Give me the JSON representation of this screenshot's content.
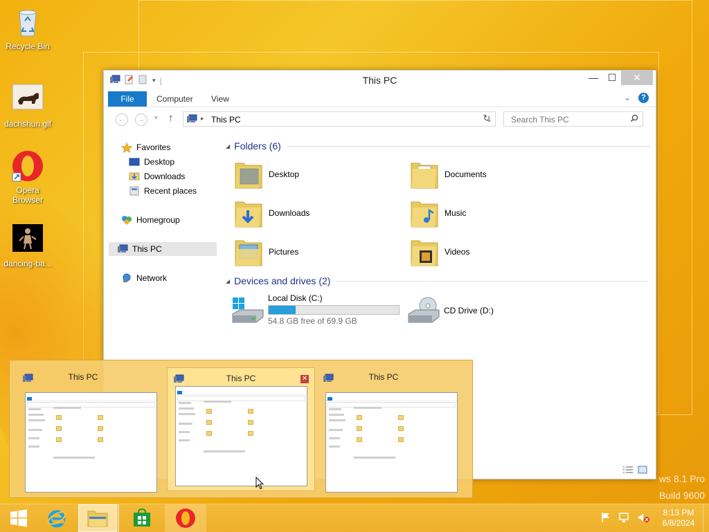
{
  "desktop": {
    "icons": [
      {
        "label": "Recycle Bin",
        "icon": "recycle-bin-icon"
      },
      {
        "label": "dachshun.gif",
        "icon": "gif-image-icon"
      },
      {
        "label": "Opera Browser",
        "icon": "opera-icon"
      },
      {
        "label": "dancing-ba...",
        "icon": "video-file-icon"
      }
    ],
    "watermark": {
      "line1": "ws 8.1 Pro",
      "line2": "Build 9600"
    }
  },
  "window": {
    "title": "This PC",
    "controls": {
      "minimize": "—",
      "maximize": "☐",
      "close": "✕"
    },
    "ribbon_tabs": {
      "file": "File",
      "computer": "Computer",
      "view": "View"
    },
    "address": {
      "path": "This PC"
    },
    "search": {
      "placeholder": "Search This PC"
    },
    "nav": {
      "favorites": "Favorites",
      "desktop": "Desktop",
      "downloads": "Downloads",
      "recent": "Recent places",
      "homegroup": "Homegroup",
      "this_pc": "This PC",
      "network": "Network"
    },
    "folders_header": "Folders (6)",
    "folders": [
      "Desktop",
      "Documents",
      "Downloads",
      "Music",
      "Pictures",
      "Videos"
    ],
    "devices_header": "Devices and drives (2)",
    "drives": {
      "local": {
        "name": "Local Disk (C:)",
        "free": "54.8 GB free of 69.9 GB",
        "used_fraction": 0.21
      },
      "cd": {
        "name": "CD Drive (D:)"
      }
    }
  },
  "thumbnails": [
    {
      "title": "This PC"
    },
    {
      "title": "This PC",
      "close": "✕"
    },
    {
      "title": "This PC"
    }
  ],
  "taskbar": {
    "time": "8:13 PM",
    "date": "6/8/2024"
  },
  "colors": {
    "accent": "#1979ca",
    "drive_fill": "#26a0da",
    "desktop": "#f2b10f"
  }
}
